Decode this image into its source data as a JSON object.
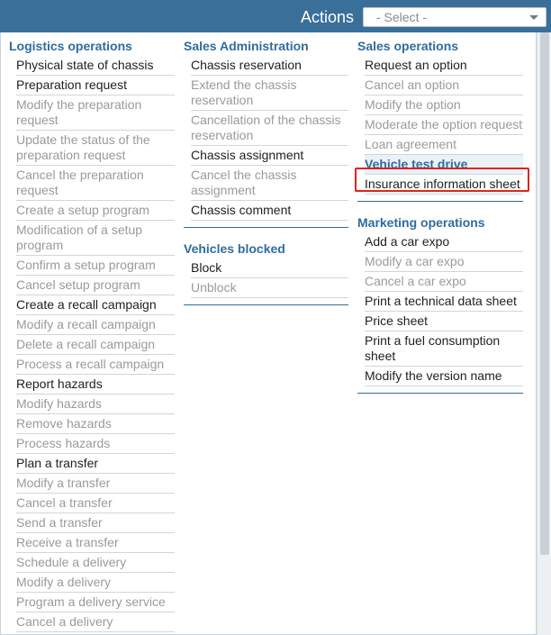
{
  "header": {
    "title": "Actions",
    "select_placeholder": "- Select -"
  },
  "columns": [
    {
      "sections": [
        {
          "title": "Logistics operations",
          "items": [
            {
              "label": "Physical state of chassis",
              "enabled": true
            },
            {
              "label": "Preparation request",
              "enabled": true
            },
            {
              "label": "Modify the preparation request",
              "enabled": false
            },
            {
              "label": "Update the status of the preparation request",
              "enabled": false
            },
            {
              "label": "Cancel the preparation request",
              "enabled": false
            },
            {
              "label": "Create a setup program",
              "enabled": false
            },
            {
              "label": "Modification of a setup program",
              "enabled": false
            },
            {
              "label": "Confirm a setup program",
              "enabled": false
            },
            {
              "label": "Cancel setup program",
              "enabled": false
            },
            {
              "label": "Create a recall campaign",
              "enabled": true
            },
            {
              "label": "Modify a recall campaign",
              "enabled": false
            },
            {
              "label": "Delete a recall campaign",
              "enabled": false
            },
            {
              "label": "Process a recall campaign",
              "enabled": false
            },
            {
              "label": "Report hazards",
              "enabled": true
            },
            {
              "label": "Modify hazards",
              "enabled": false
            },
            {
              "label": "Remove hazards",
              "enabled": false
            },
            {
              "label": "Process hazards",
              "enabled": false
            },
            {
              "label": "Plan a transfer",
              "enabled": true
            },
            {
              "label": "Modify a transfer",
              "enabled": false
            },
            {
              "label": "Cancel a transfer",
              "enabled": false
            },
            {
              "label": "Send a transfer",
              "enabled": false
            },
            {
              "label": "Receive a transfer",
              "enabled": false
            },
            {
              "label": "Schedule a delivery",
              "enabled": false
            },
            {
              "label": "Modify a delivery",
              "enabled": false
            },
            {
              "label": "Program a delivery service",
              "enabled": false
            },
            {
              "label": "Cancel a delivery",
              "enabled": false
            }
          ]
        }
      ]
    },
    {
      "sections": [
        {
          "title": "Sales Administration",
          "items": [
            {
              "label": "Chassis reservation",
              "enabled": true
            },
            {
              "label": "Extend the chassis reservation",
              "enabled": false
            },
            {
              "label": "Cancellation of the chassis reservation",
              "enabled": false
            },
            {
              "label": "Chassis assignment",
              "enabled": true
            },
            {
              "label": "Cancel the chassis assignment",
              "enabled": false
            },
            {
              "label": "Chassis comment",
              "enabled": true
            }
          ]
        },
        {
          "title": "Vehicles blocked",
          "items": [
            {
              "label": "Block",
              "enabled": true
            },
            {
              "label": "Unblock",
              "enabled": false
            }
          ]
        }
      ]
    },
    {
      "sections": [
        {
          "title": "Sales operations",
          "items": [
            {
              "label": "Request an option",
              "enabled": true
            },
            {
              "label": "Cancel an option",
              "enabled": false
            },
            {
              "label": "Modify the option",
              "enabled": false
            },
            {
              "label": "Moderate the option request",
              "enabled": false
            },
            {
              "label": "Loan agreement",
              "enabled": false
            },
            {
              "label": "Vehicle test drive",
              "enabled": true,
              "selected": true
            },
            {
              "label": "Insurance information sheet",
              "enabled": true
            }
          ]
        },
        {
          "title": "Marketing operations",
          "items": [
            {
              "label": "Add a car expo",
              "enabled": true
            },
            {
              "label": "Modify a car expo",
              "enabled": false
            },
            {
              "label": "Cancel a car expo",
              "enabled": false
            },
            {
              "label": "Print a technical data sheet",
              "enabled": true
            },
            {
              "label": "Price sheet",
              "enabled": true
            },
            {
              "label": "Print a fuel consumption sheet",
              "enabled": true
            },
            {
              "label": "Modify the version name",
              "enabled": true
            }
          ]
        }
      ]
    }
  ],
  "colors": {
    "header_bg": "#3a6f9a",
    "section_title": "#2f6c9c",
    "disabled_text": "#9a9a9a",
    "highlight": "#e2231a"
  }
}
